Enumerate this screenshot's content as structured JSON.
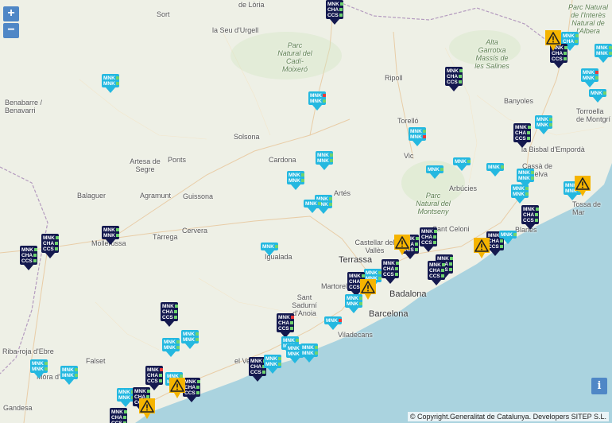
{
  "controls": {
    "zoom_in": "+",
    "zoom_out": "−",
    "info": "i"
  },
  "attribution": "© Copyright.Generalitat de Catalunya. Developers SITEP S.L.",
  "colors": {
    "cyan_marker": "#24b8e0",
    "navy_marker": "#14194f",
    "warning": "#f5b400",
    "sea": "#aad3df",
    "land": "#eef0e6",
    "status_green": "#6fd36f",
    "status_red": "#e83a3a"
  },
  "places": [
    {
      "name": "de Lòria"
    },
    {
      "name": "Sort"
    },
    {
      "name": "la Seu d'Urgell"
    },
    {
      "name": "Parc Natural del Cadí-Moixeró"
    },
    {
      "name": "Alta Garrotxa Massís de les Salines"
    },
    {
      "name": "Parc Natural de l'Interès Natural de l'Albera"
    },
    {
      "name": "Benabarre / Benavarri"
    },
    {
      "name": "Ripoll"
    },
    {
      "name": "Banyoles"
    },
    {
      "name": "Torroella de Montgrí"
    },
    {
      "name": "Solsona"
    },
    {
      "name": "Torelló"
    },
    {
      "name": "la Bisbal d'Empordà"
    },
    {
      "name": "Artesa de Segre"
    },
    {
      "name": "Ponts"
    },
    {
      "name": "Cardona"
    },
    {
      "name": "Vic"
    },
    {
      "name": "Arbúcies"
    },
    {
      "name": "Cassà de la Selva"
    },
    {
      "name": "Balaguer"
    },
    {
      "name": "Agramunt"
    },
    {
      "name": "Guissona"
    },
    {
      "name": "Artés"
    },
    {
      "name": "Parc Natural del Montseny"
    },
    {
      "name": "Tàrrega"
    },
    {
      "name": "Cervera"
    },
    {
      "name": "Castellar del Vallès"
    },
    {
      "name": "Sant Celoni"
    },
    {
      "name": "Tossa de Mar"
    },
    {
      "name": "Blanes"
    },
    {
      "name": "Terrassa"
    },
    {
      "name": "Igualada"
    },
    {
      "name": "Martorell"
    },
    {
      "name": "Badalona"
    },
    {
      "name": "Sant Sadurní d'Anoia"
    },
    {
      "name": "Barcelona"
    },
    {
      "name": "Viladecans"
    },
    {
      "name": "Riba-roja d'Ebre"
    },
    {
      "name": "el Vendrell"
    },
    {
      "name": "Falset"
    },
    {
      "name": "Móra d'Ebre"
    },
    {
      "name": "Gandesa"
    },
    {
      "name": "Mollerussa"
    }
  ],
  "marker_labels": {
    "mnk": "MNK",
    "cha": "CHA",
    "ccs": "CCS"
  }
}
